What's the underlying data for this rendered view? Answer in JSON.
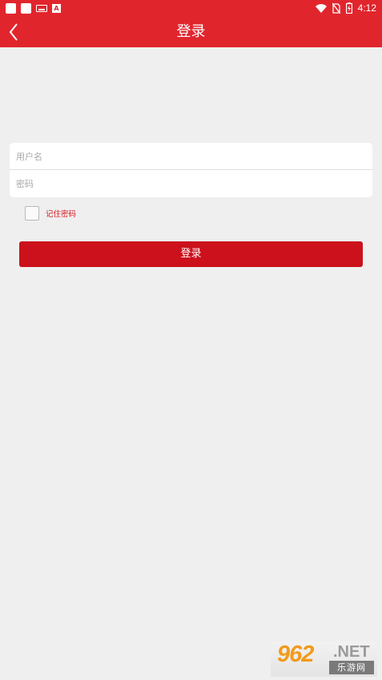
{
  "status_bar": {
    "time": "4:12",
    "left_icons": [
      "notification-square-icon",
      "notification-square-icon",
      "keyboard-icon",
      "font-a-icon"
    ],
    "right_icons": [
      "wifi-icon",
      "no-sim-icon",
      "battery-charging-icon"
    ]
  },
  "header": {
    "title": "登录",
    "back_icon": "chevron-left-icon",
    "color": "#e1252d"
  },
  "form": {
    "username_placeholder": "用户名",
    "password_placeholder": "密码",
    "remember_label": "记住密码",
    "remember_checked": false,
    "login_label": "登录",
    "button_color": "#cc111c"
  },
  "watermark": {
    "number": "962",
    "suffix": ".NET",
    "chinese": "乐游网"
  }
}
